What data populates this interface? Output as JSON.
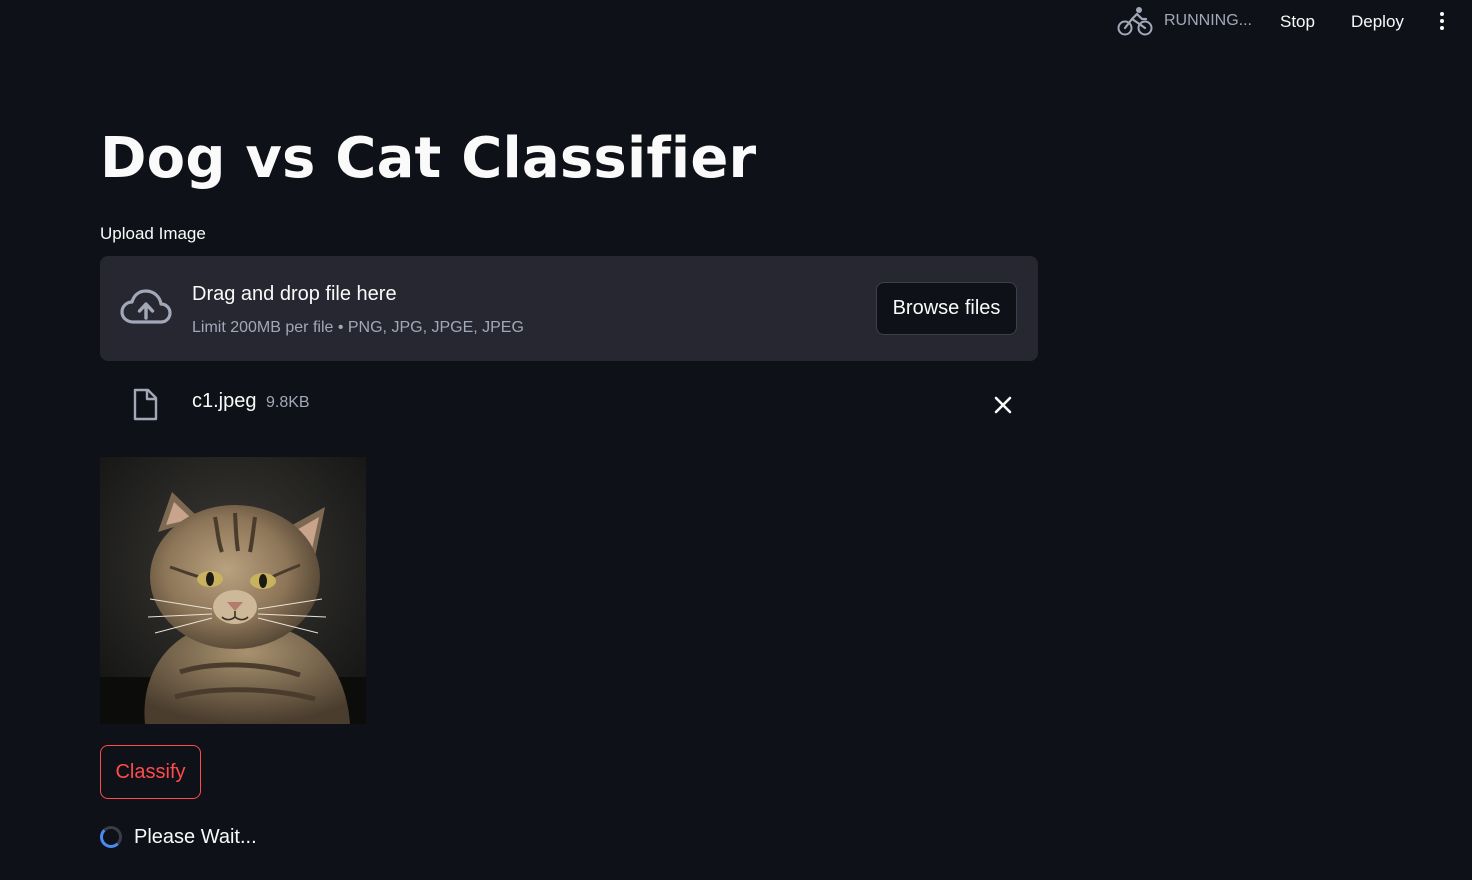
{
  "header": {
    "status_text": "RUNNING...",
    "status_icon": "cyclist-icon",
    "stop_label": "Stop",
    "deploy_label": "Deploy",
    "menu_icon": "vertical-dots-icon"
  },
  "main": {
    "title": "Dog vs Cat Classifier",
    "uploader": {
      "label": "Upload Image",
      "drop_text": "Drag and drop file here",
      "limit_text": "Limit 200MB per file • PNG, JPG, JPGE, JPEG",
      "browse_label": "Browse files",
      "upload_icon": "cloud-upload-icon"
    },
    "file": {
      "name": "c1.jpeg",
      "size": "9.8KB",
      "icon": "file-icon",
      "remove_icon": "close-icon"
    },
    "image": {
      "subject": "tabby kitten photo"
    },
    "classify_label": "Classify",
    "spinner_text": "Please Wait..."
  },
  "colors": {
    "background": "#0e1117",
    "panel": "#262730",
    "accent": "#ff4b4b",
    "muted_text": "#a3a8b8",
    "spinner": "#4a8cf0"
  }
}
